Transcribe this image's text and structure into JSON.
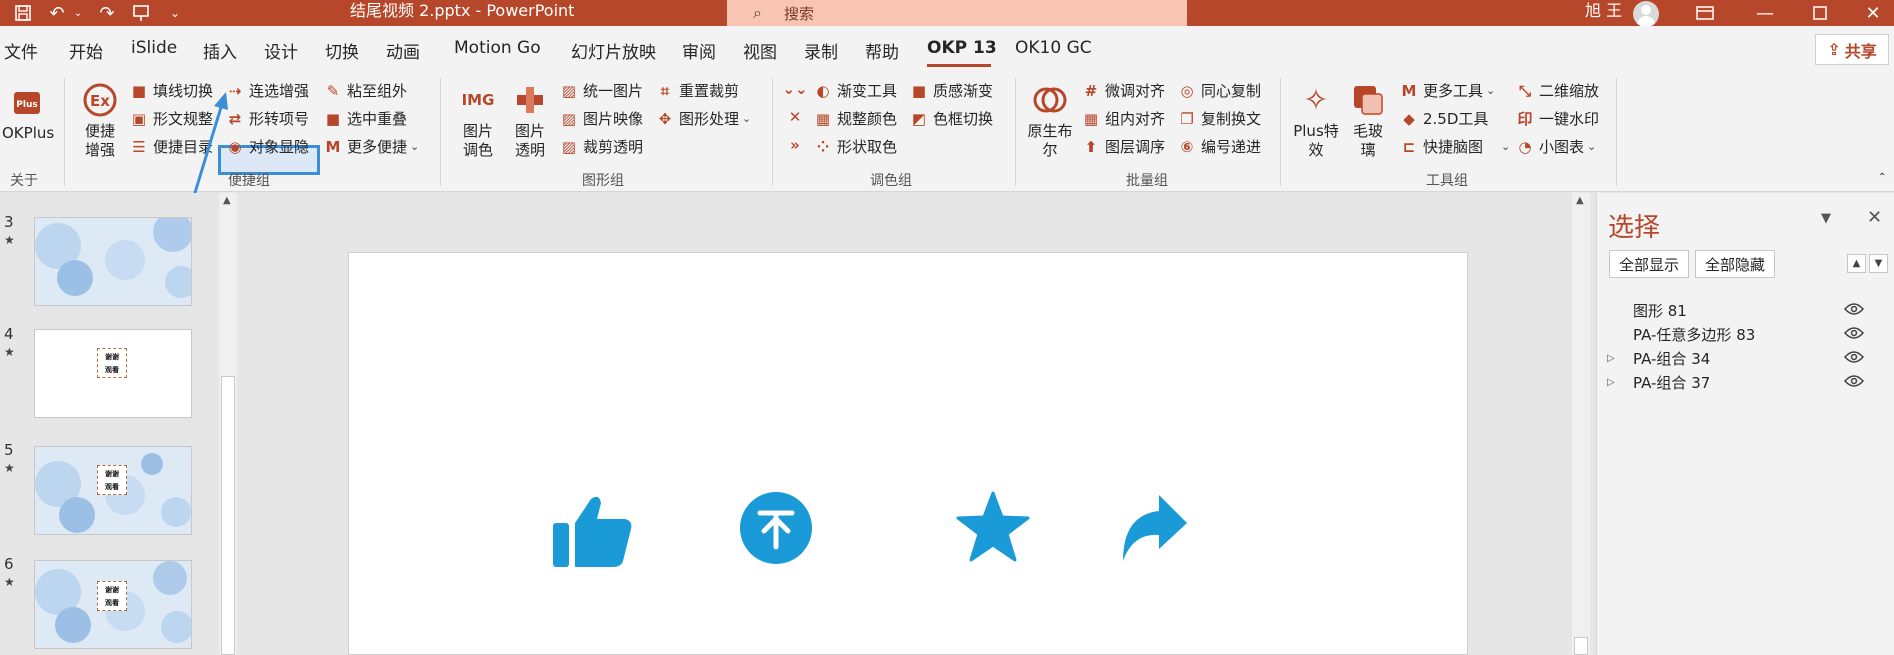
{
  "titlebar": {
    "title": "结尾视频 2.pptx - PowerPoint",
    "search_placeholder": "搜索",
    "user": "旭 王"
  },
  "menu": {
    "tabs": [
      "文件",
      "开始",
      "iSlide",
      "插入",
      "设计",
      "切换",
      "动画",
      "Motion Go",
      "幻灯片放映",
      "审阅",
      "视图",
      "录制",
      "帮助",
      "OKP 13",
      "OK10 GC"
    ],
    "share": "共享"
  },
  "ribbon": {
    "okplus": {
      "label": "OKPlus",
      "group": "关于"
    },
    "quick": {
      "big_label": "便捷\n增强",
      "items": [
        "填线切换",
        "形文规整",
        "便捷目录",
        "连选增强",
        "形转项号",
        "对象显隐",
        "粘至组外",
        "选中重叠",
        "更多便捷"
      ],
      "group": "便捷组"
    },
    "shape": {
      "big1": "图片\n调色",
      "big2": "图片\n透明",
      "items": [
        "统一图片",
        "图片映像",
        "裁剪透明",
        "重置裁剪",
        "图形处理"
      ],
      "group": "图形组"
    },
    "color": {
      "items": [
        "渐变工具",
        "规整颜色",
        "形状取色",
        "质感渐变",
        "色框切换"
      ],
      "group": "调色组"
    },
    "batch": {
      "big": "原生布\n尔",
      "items": [
        "微调对齐",
        "组内对齐",
        "图层调序",
        "同心复制",
        "复制换文",
        "编号递进"
      ],
      "group": "批量组"
    },
    "tools": {
      "big1": "Plus特\n效",
      "big2": "毛玻\n璃",
      "items": [
        "更多工具",
        "2.5D工具",
        "快捷脑图",
        "二维缩放",
        "一键水印",
        "小图表"
      ],
      "group": "工具组"
    }
  },
  "thumbnails": [
    {
      "num": "3",
      "type": "bubbles"
    },
    {
      "num": "4",
      "type": "thanks-white"
    },
    {
      "num": "5",
      "type": "bubbles-thanks"
    },
    {
      "num": "6",
      "type": "bubbles-thanks"
    }
  ],
  "thanks_text": "谢谢\n观看",
  "selection_pane": {
    "title": "选择",
    "show_all": "全部显示",
    "hide_all": "全部隐藏",
    "items": [
      {
        "name": "图形 81",
        "expandable": false
      },
      {
        "name": "PA-任意多边形 83",
        "expandable": false
      },
      {
        "name": "PA-组合 34",
        "expandable": true
      },
      {
        "name": "PA-组合 37",
        "expandable": true
      }
    ]
  },
  "colors": {
    "brand": "#b7472a",
    "icon_blue": "#1a9ad6",
    "highlight": "#3b8fd8"
  },
  "slide_icons": [
    "thumbs-up-icon",
    "down-arrow-circle-icon",
    "star-icon",
    "share-arrow-icon"
  ]
}
